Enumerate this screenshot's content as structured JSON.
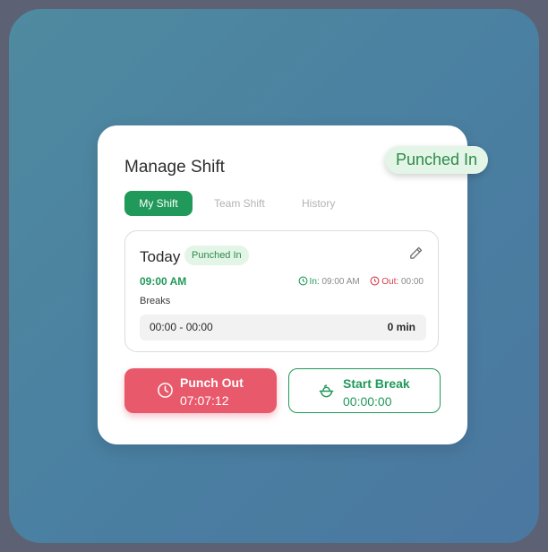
{
  "status_badge": "Punched In",
  "card": {
    "title": "Manage Shift",
    "tabs": [
      {
        "label": "My Shift",
        "active": true
      },
      {
        "label": "Team Shift",
        "active": false
      },
      {
        "label": "History",
        "active": false
      }
    ]
  },
  "today": {
    "label": "Today",
    "badge": "Punched In",
    "start_time": "09:00 AM",
    "in_label": "In:",
    "in_time": "09:00 AM",
    "out_label": "Out:",
    "out_time": "00:00",
    "breaks_label": "Breaks",
    "break_range": "00:00  - 00:00",
    "break_total": "0 min"
  },
  "actions": {
    "punch_out": {
      "label": "Punch Out",
      "timer": "07:07:12",
      "icon": "clock-icon"
    },
    "start_break": {
      "label": "Start Break",
      "timer": "00:00:00",
      "icon": "food-bowl-icon"
    }
  },
  "colors": {
    "primary_green": "#20995a",
    "danger_red": "#e85a6b",
    "badge_bg": "#e3f5e7"
  }
}
